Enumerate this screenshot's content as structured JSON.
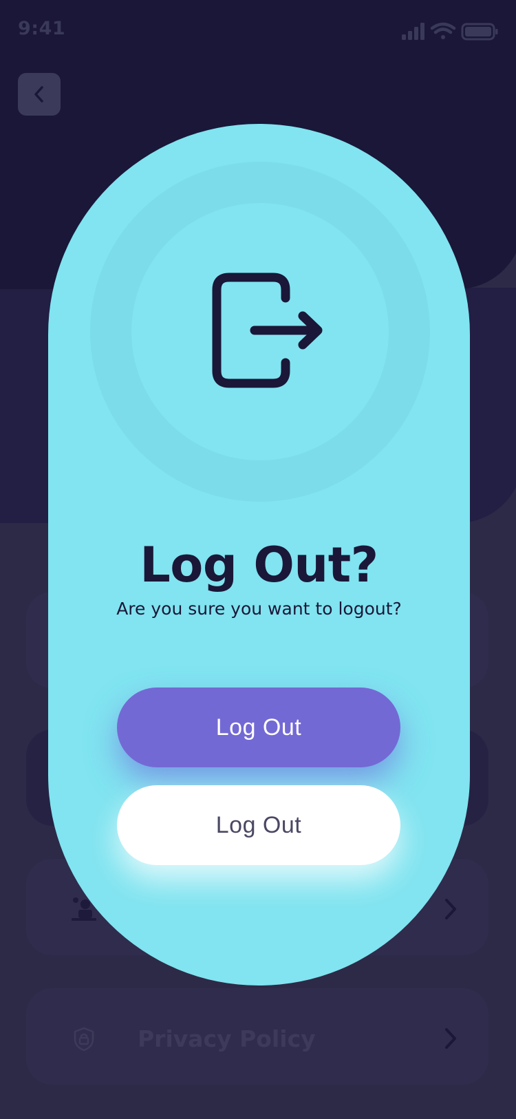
{
  "status_bar": {
    "time": "9:41"
  },
  "background": {
    "list_rows": [
      {
        "label": "",
        "icon": "person-desk-icon"
      },
      {
        "label": "Privacy Policy",
        "icon": "lock-icon"
      }
    ]
  },
  "dialog": {
    "icon": "logout-icon",
    "title": "Log Out?",
    "message": "Are you sure you want to logout?",
    "primary_label": "Log Out",
    "secondary_label": "Log Out"
  },
  "colors": {
    "modal_background": "#81e4f0",
    "primary_button": "#7369d4",
    "secondary_button": "#ffffff",
    "screen_background": "#1a1738"
  }
}
